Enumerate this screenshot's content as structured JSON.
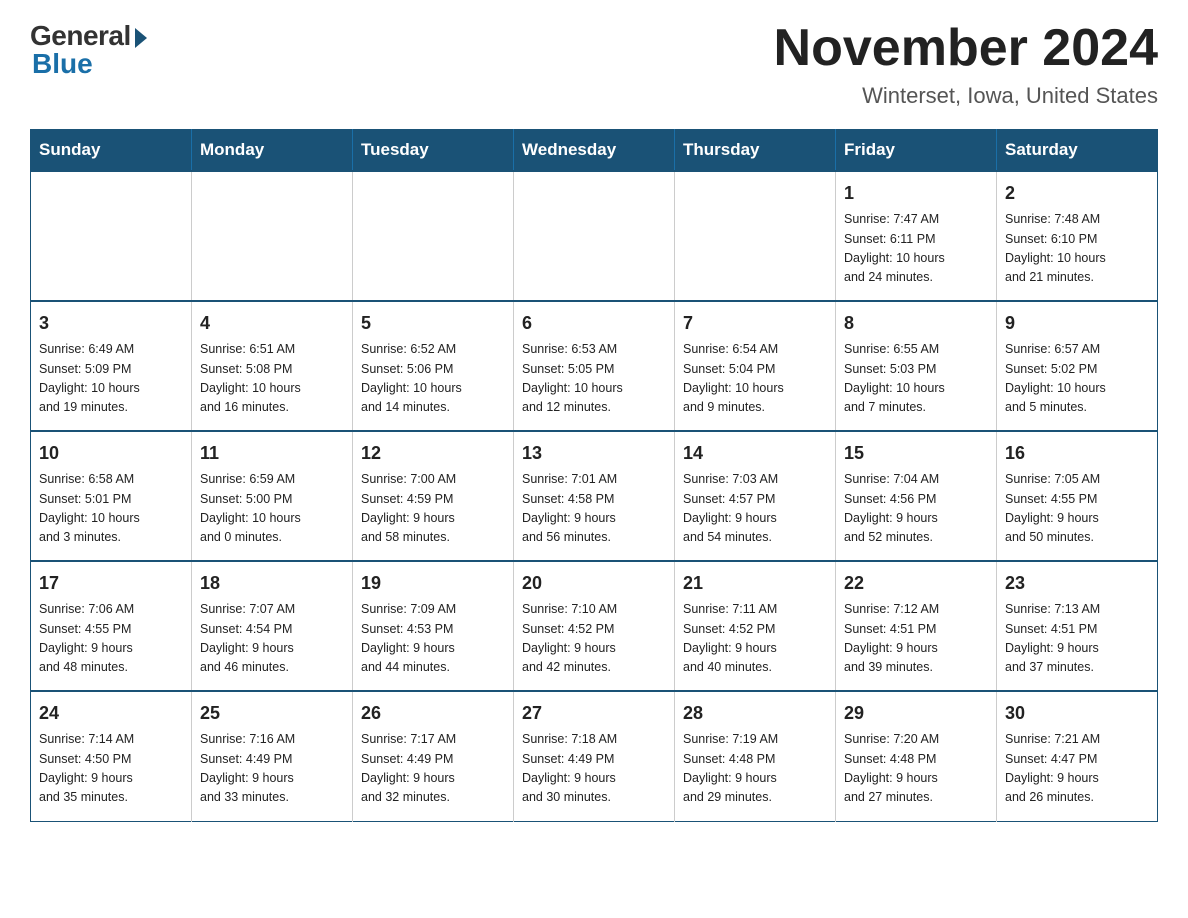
{
  "header": {
    "logo_general": "General",
    "logo_blue": "Blue",
    "month_title": "November 2024",
    "location": "Winterset, Iowa, United States"
  },
  "calendar": {
    "days_of_week": [
      "Sunday",
      "Monday",
      "Tuesday",
      "Wednesday",
      "Thursday",
      "Friday",
      "Saturday"
    ],
    "weeks": [
      [
        {
          "day": "",
          "info": ""
        },
        {
          "day": "",
          "info": ""
        },
        {
          "day": "",
          "info": ""
        },
        {
          "day": "",
          "info": ""
        },
        {
          "day": "",
          "info": ""
        },
        {
          "day": "1",
          "info": "Sunrise: 7:47 AM\nSunset: 6:11 PM\nDaylight: 10 hours\nand 24 minutes."
        },
        {
          "day": "2",
          "info": "Sunrise: 7:48 AM\nSunset: 6:10 PM\nDaylight: 10 hours\nand 21 minutes."
        }
      ],
      [
        {
          "day": "3",
          "info": "Sunrise: 6:49 AM\nSunset: 5:09 PM\nDaylight: 10 hours\nand 19 minutes."
        },
        {
          "day": "4",
          "info": "Sunrise: 6:51 AM\nSunset: 5:08 PM\nDaylight: 10 hours\nand 16 minutes."
        },
        {
          "day": "5",
          "info": "Sunrise: 6:52 AM\nSunset: 5:06 PM\nDaylight: 10 hours\nand 14 minutes."
        },
        {
          "day": "6",
          "info": "Sunrise: 6:53 AM\nSunset: 5:05 PM\nDaylight: 10 hours\nand 12 minutes."
        },
        {
          "day": "7",
          "info": "Sunrise: 6:54 AM\nSunset: 5:04 PM\nDaylight: 10 hours\nand 9 minutes."
        },
        {
          "day": "8",
          "info": "Sunrise: 6:55 AM\nSunset: 5:03 PM\nDaylight: 10 hours\nand 7 minutes."
        },
        {
          "day": "9",
          "info": "Sunrise: 6:57 AM\nSunset: 5:02 PM\nDaylight: 10 hours\nand 5 minutes."
        }
      ],
      [
        {
          "day": "10",
          "info": "Sunrise: 6:58 AM\nSunset: 5:01 PM\nDaylight: 10 hours\nand 3 minutes."
        },
        {
          "day": "11",
          "info": "Sunrise: 6:59 AM\nSunset: 5:00 PM\nDaylight: 10 hours\nand 0 minutes."
        },
        {
          "day": "12",
          "info": "Sunrise: 7:00 AM\nSunset: 4:59 PM\nDaylight: 9 hours\nand 58 minutes."
        },
        {
          "day": "13",
          "info": "Sunrise: 7:01 AM\nSunset: 4:58 PM\nDaylight: 9 hours\nand 56 minutes."
        },
        {
          "day": "14",
          "info": "Sunrise: 7:03 AM\nSunset: 4:57 PM\nDaylight: 9 hours\nand 54 minutes."
        },
        {
          "day": "15",
          "info": "Sunrise: 7:04 AM\nSunset: 4:56 PM\nDaylight: 9 hours\nand 52 minutes."
        },
        {
          "day": "16",
          "info": "Sunrise: 7:05 AM\nSunset: 4:55 PM\nDaylight: 9 hours\nand 50 minutes."
        }
      ],
      [
        {
          "day": "17",
          "info": "Sunrise: 7:06 AM\nSunset: 4:55 PM\nDaylight: 9 hours\nand 48 minutes."
        },
        {
          "day": "18",
          "info": "Sunrise: 7:07 AM\nSunset: 4:54 PM\nDaylight: 9 hours\nand 46 minutes."
        },
        {
          "day": "19",
          "info": "Sunrise: 7:09 AM\nSunset: 4:53 PM\nDaylight: 9 hours\nand 44 minutes."
        },
        {
          "day": "20",
          "info": "Sunrise: 7:10 AM\nSunset: 4:52 PM\nDaylight: 9 hours\nand 42 minutes."
        },
        {
          "day": "21",
          "info": "Sunrise: 7:11 AM\nSunset: 4:52 PM\nDaylight: 9 hours\nand 40 minutes."
        },
        {
          "day": "22",
          "info": "Sunrise: 7:12 AM\nSunset: 4:51 PM\nDaylight: 9 hours\nand 39 minutes."
        },
        {
          "day": "23",
          "info": "Sunrise: 7:13 AM\nSunset: 4:51 PM\nDaylight: 9 hours\nand 37 minutes."
        }
      ],
      [
        {
          "day": "24",
          "info": "Sunrise: 7:14 AM\nSunset: 4:50 PM\nDaylight: 9 hours\nand 35 minutes."
        },
        {
          "day": "25",
          "info": "Sunrise: 7:16 AM\nSunset: 4:49 PM\nDaylight: 9 hours\nand 33 minutes."
        },
        {
          "day": "26",
          "info": "Sunrise: 7:17 AM\nSunset: 4:49 PM\nDaylight: 9 hours\nand 32 minutes."
        },
        {
          "day": "27",
          "info": "Sunrise: 7:18 AM\nSunset: 4:49 PM\nDaylight: 9 hours\nand 30 minutes."
        },
        {
          "day": "28",
          "info": "Sunrise: 7:19 AM\nSunset: 4:48 PM\nDaylight: 9 hours\nand 29 minutes."
        },
        {
          "day": "29",
          "info": "Sunrise: 7:20 AM\nSunset: 4:48 PM\nDaylight: 9 hours\nand 27 minutes."
        },
        {
          "day": "30",
          "info": "Sunrise: 7:21 AM\nSunset: 4:47 PM\nDaylight: 9 hours\nand 26 minutes."
        }
      ]
    ]
  }
}
